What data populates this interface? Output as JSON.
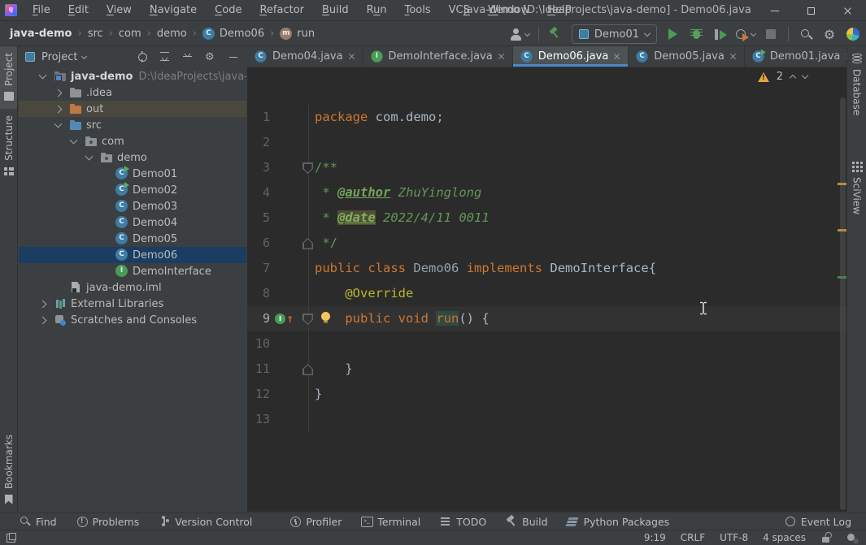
{
  "window": {
    "title": "java-demo [D:\\IdeaProjects\\java-demo] - Demo06.java",
    "menus": [
      {
        "label": "File",
        "u": 0
      },
      {
        "label": "Edit",
        "u": 0
      },
      {
        "label": "View",
        "u": 0
      },
      {
        "label": "Navigate",
        "u": 0
      },
      {
        "label": "Code",
        "u": 0
      },
      {
        "label": "Refactor",
        "u": 0
      },
      {
        "label": "Build",
        "u": 0
      },
      {
        "label": "Run",
        "u": 1
      },
      {
        "label": "Tools",
        "u": 0
      },
      {
        "label": "VCS",
        "u": 2
      },
      {
        "label": "Window",
        "u": 0
      },
      {
        "label": "Help",
        "u": 0
      }
    ]
  },
  "navbar": {
    "breadcrumbs": [
      {
        "label": "java-demo",
        "bold": true
      },
      {
        "label": "src"
      },
      {
        "label": "com"
      },
      {
        "label": "demo"
      },
      {
        "label": "Demo06",
        "icon": "class"
      },
      {
        "label": "run",
        "icon": "method"
      }
    ],
    "run_config": "Demo01"
  },
  "tabs": [
    {
      "label": "Demo04.java",
      "icon": "class"
    },
    {
      "label": "DemoInterface.java",
      "icon": "interface"
    },
    {
      "label": "Demo06.java",
      "icon": "class",
      "active": true
    },
    {
      "label": "Demo05.java",
      "icon": "class"
    },
    {
      "label": "Demo01.java",
      "icon": "class-run"
    }
  ],
  "project": {
    "title": "Project",
    "tree": [
      {
        "label": "java-demo",
        "suffix": "D:\\IdeaProjects\\java-demo",
        "depth": 0,
        "arrow": "down",
        "icon": "folder-root",
        "bold": true
      },
      {
        "label": ".idea",
        "depth": 1,
        "arrow": "right",
        "icon": "folder-gray"
      },
      {
        "label": "out",
        "depth": 1,
        "arrow": "right",
        "icon": "folder-orange",
        "state": "hover"
      },
      {
        "label": "src",
        "depth": 1,
        "arrow": "down",
        "icon": "folder-blue"
      },
      {
        "label": "com",
        "depth": 2,
        "arrow": "down",
        "icon": "package"
      },
      {
        "label": "demo",
        "depth": 3,
        "arrow": "down",
        "icon": "package"
      },
      {
        "label": "Demo01",
        "depth": 4,
        "icon": "class-run"
      },
      {
        "label": "Demo02",
        "depth": 4,
        "icon": "class-run"
      },
      {
        "label": "Demo03",
        "depth": 4,
        "icon": "class"
      },
      {
        "label": "Demo04",
        "depth": 4,
        "icon": "class"
      },
      {
        "label": "Demo05",
        "depth": 4,
        "icon": "class"
      },
      {
        "label": "Demo06",
        "depth": 4,
        "icon": "class",
        "state": "selected"
      },
      {
        "label": "DemoInterface",
        "depth": 4,
        "icon": "interface"
      },
      {
        "label": "java-demo.iml",
        "depth": 1,
        "icon": "iml"
      },
      {
        "label": "External Libraries",
        "depth": 0,
        "arrow": "right",
        "icon": "lib"
      },
      {
        "label": "Scratches and Consoles",
        "depth": 0,
        "arrow": "right",
        "icon": "scratch"
      }
    ]
  },
  "editor": {
    "inspection_warnings": "2",
    "lines": [
      {
        "n": "1",
        "tokens": [
          [
            "kw",
            "package"
          ],
          [
            "pl",
            " com.demo;"
          ]
        ]
      },
      {
        "n": "2",
        "tokens": []
      },
      {
        "n": "3",
        "fold": "start",
        "tokens": [
          [
            "cm",
            "/**"
          ]
        ]
      },
      {
        "n": "4",
        "tokens": [
          [
            "cm",
            " * "
          ],
          [
            "tag",
            "@author"
          ],
          [
            "cmi",
            " ZhuYinglong"
          ]
        ]
      },
      {
        "n": "5",
        "tokens": [
          [
            "cm",
            " * "
          ],
          [
            "taghl",
            "@date"
          ],
          [
            "cmi",
            " 2022/4/11 0011"
          ]
        ]
      },
      {
        "n": "6",
        "fold": "end",
        "tokens": [
          [
            "cm",
            " */"
          ]
        ]
      },
      {
        "n": "7",
        "tokens": [
          [
            "kw",
            "public"
          ],
          [
            "pl",
            " "
          ],
          [
            "kw",
            "class"
          ],
          [
            "pl",
            " "
          ],
          [
            "cls",
            "Demo06"
          ],
          [
            "pl",
            " "
          ],
          [
            "kw",
            "implements"
          ],
          [
            "pl",
            " "
          ],
          [
            "iface",
            "DemoInterface"
          ],
          [
            "pl",
            "{"
          ]
        ]
      },
      {
        "n": "8",
        "tokens": [
          [
            "pl",
            "    "
          ],
          [
            "ann",
            "@Override"
          ]
        ]
      },
      {
        "n": "9",
        "fold": "start",
        "impl": true,
        "bulb": true,
        "current": true,
        "tokens": [
          [
            "pl",
            "    "
          ],
          [
            "kw",
            "public"
          ],
          [
            "pl",
            " "
          ],
          [
            "kw",
            "void"
          ],
          [
            "pl",
            " "
          ],
          [
            "mhl",
            "run"
          ],
          [
            "pl",
            "() {"
          ]
        ]
      },
      {
        "n": "10",
        "tokens": []
      },
      {
        "n": "11",
        "fold": "end",
        "tokens": [
          [
            "pl",
            "    }"
          ]
        ]
      },
      {
        "n": "12",
        "tokens": [
          [
            "pl",
            "}"
          ]
        ]
      },
      {
        "n": "13",
        "tokens": []
      }
    ]
  },
  "stripes": {
    "left": [
      {
        "label": "Project",
        "icon": "folder",
        "active": true
      },
      {
        "label": "Structure",
        "icon": "structure"
      }
    ],
    "left_bottom": [
      {
        "label": "Bookmarks",
        "icon": "bookmark"
      }
    ],
    "right": [
      {
        "label": "Database",
        "icon": "database"
      },
      {
        "label": "SciView",
        "icon": "grid"
      }
    ]
  },
  "bottom_bar": {
    "items": [
      {
        "label": "Find",
        "icon": "find"
      },
      {
        "label": "Problems",
        "icon": "prob"
      },
      {
        "label": "Version Control",
        "icon": "branch"
      },
      {
        "label": "Profiler",
        "icon": "prof",
        "gap": true
      },
      {
        "label": "Terminal",
        "icon": "term"
      },
      {
        "label": "TODO",
        "icon": "todo"
      },
      {
        "label": "Build",
        "icon": "hammer"
      },
      {
        "label": "Python Packages",
        "icon": "layers"
      }
    ],
    "right": {
      "label": "Event Log",
      "icon": "event"
    }
  },
  "status_bar": {
    "position": "9:19",
    "line_separator": "CRLF",
    "encoding": "UTF-8",
    "indent": "4 spaces"
  }
}
